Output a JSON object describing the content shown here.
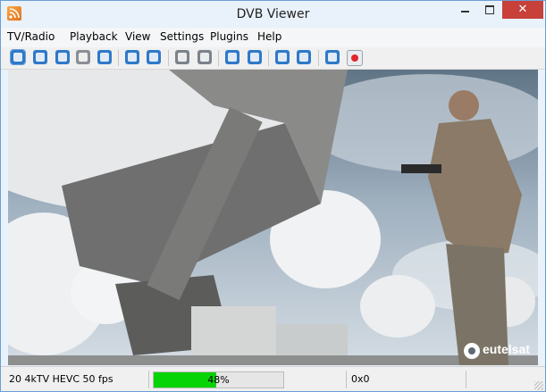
{
  "window": {
    "title": "DVB Viewer"
  },
  "menu": [
    "TV/Radio",
    "Playback",
    "View",
    "Settings",
    "Plugins",
    "Help"
  ],
  "toolbar_icons": [
    "osd-toggle-icon",
    "fullscreen-icon",
    "channel-list-icon",
    "menu-icon",
    "epg-icon",
    "back-icon",
    "forward-icon",
    "record-list-icon",
    "timer-add-icon",
    "previous-channel-icon",
    "previous-favorite-icon",
    "list-icon",
    "settings-icon",
    "info-icon",
    "record-icon"
  ],
  "video": {
    "watermark": "eutelsat"
  },
  "status": {
    "channel_info": "20 4kTV HEVC 50 fps",
    "signal_quality_percent": 48,
    "signal_label": "48%",
    "error_code": "0x0"
  },
  "colors": {
    "accent_blue": "#2f79c8",
    "close_red": "#c7403a",
    "progress_green": "#06d406",
    "record_red": "#e0262a"
  }
}
